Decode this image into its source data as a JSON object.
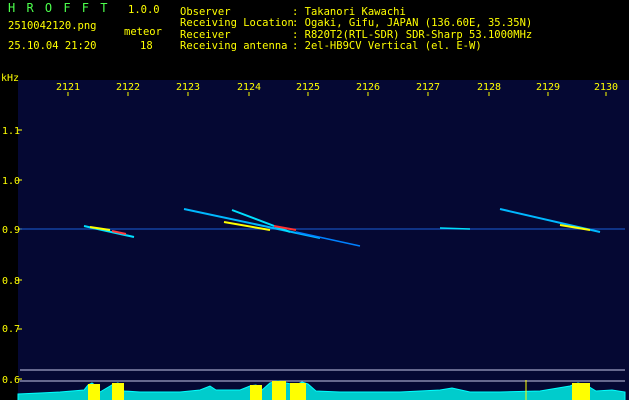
{
  "app": {
    "title": "H R O F F T",
    "version": "1.0.0"
  },
  "file": {
    "name": "2510042120.png",
    "datetime": "25.10.04 21:20"
  },
  "meteor": {
    "label": "meteor",
    "count": "18"
  },
  "info": [
    {
      "label": "Observer",
      "value": ": Takanori Kawachi"
    },
    {
      "label": "Receiving Location",
      "value": ": Ogaki, Gifu, JAPAN (136.60E, 35.35N)"
    },
    {
      "label": "Receiver",
      "value": ": R820T2(RTL-SDR) SDR-Sharp 53.1000MHz"
    },
    {
      "label": "Receiving antenna",
      "value": ": 2el-HB9CV Vertical (el. E-W)"
    }
  ],
  "axis": {
    "unit": "kHz",
    "x_ticks": [
      "2121",
      "2122",
      "2123",
      "2124",
      "2125",
      "2126",
      "2127",
      "2128",
      "2129",
      "2130"
    ],
    "y_ticks": [
      "1.1",
      "1.0",
      "0.9",
      "0.8",
      "0.7",
      "0.6"
    ]
  },
  "colors": {
    "background": "#050833",
    "label": "#ffff00",
    "title": "#4cff4c",
    "trace": "#00ffff"
  }
}
